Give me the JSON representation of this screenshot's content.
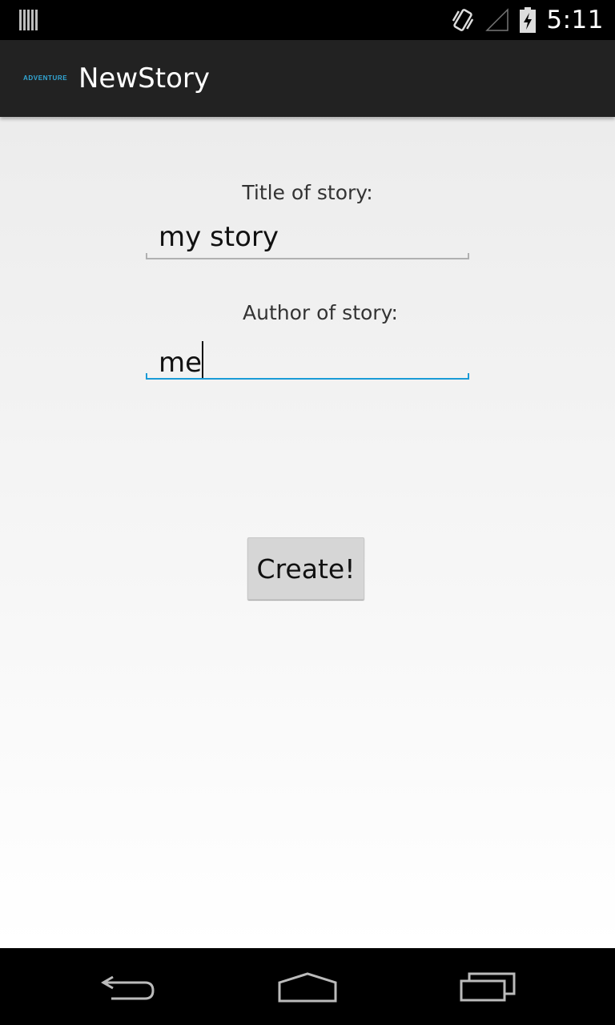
{
  "status_bar": {
    "time": "5:11",
    "icons": [
      "notification-bars-icon",
      "vibrate-icon",
      "no-signal-icon",
      "battery-charging-icon"
    ]
  },
  "action_bar": {
    "logo_text": "ADVENTURE",
    "title": "NewStory"
  },
  "form": {
    "title_label": "Title of story:",
    "title_value": "my story",
    "author_label": "Author of story:",
    "author_value": "me",
    "create_button": "Create!"
  },
  "nav_bar": {
    "icons": [
      "back-icon",
      "home-icon",
      "recent-apps-icon"
    ]
  },
  "colors": {
    "accent": "#1a9bd7",
    "action_bar": "#222222",
    "status_bar": "#000000"
  }
}
